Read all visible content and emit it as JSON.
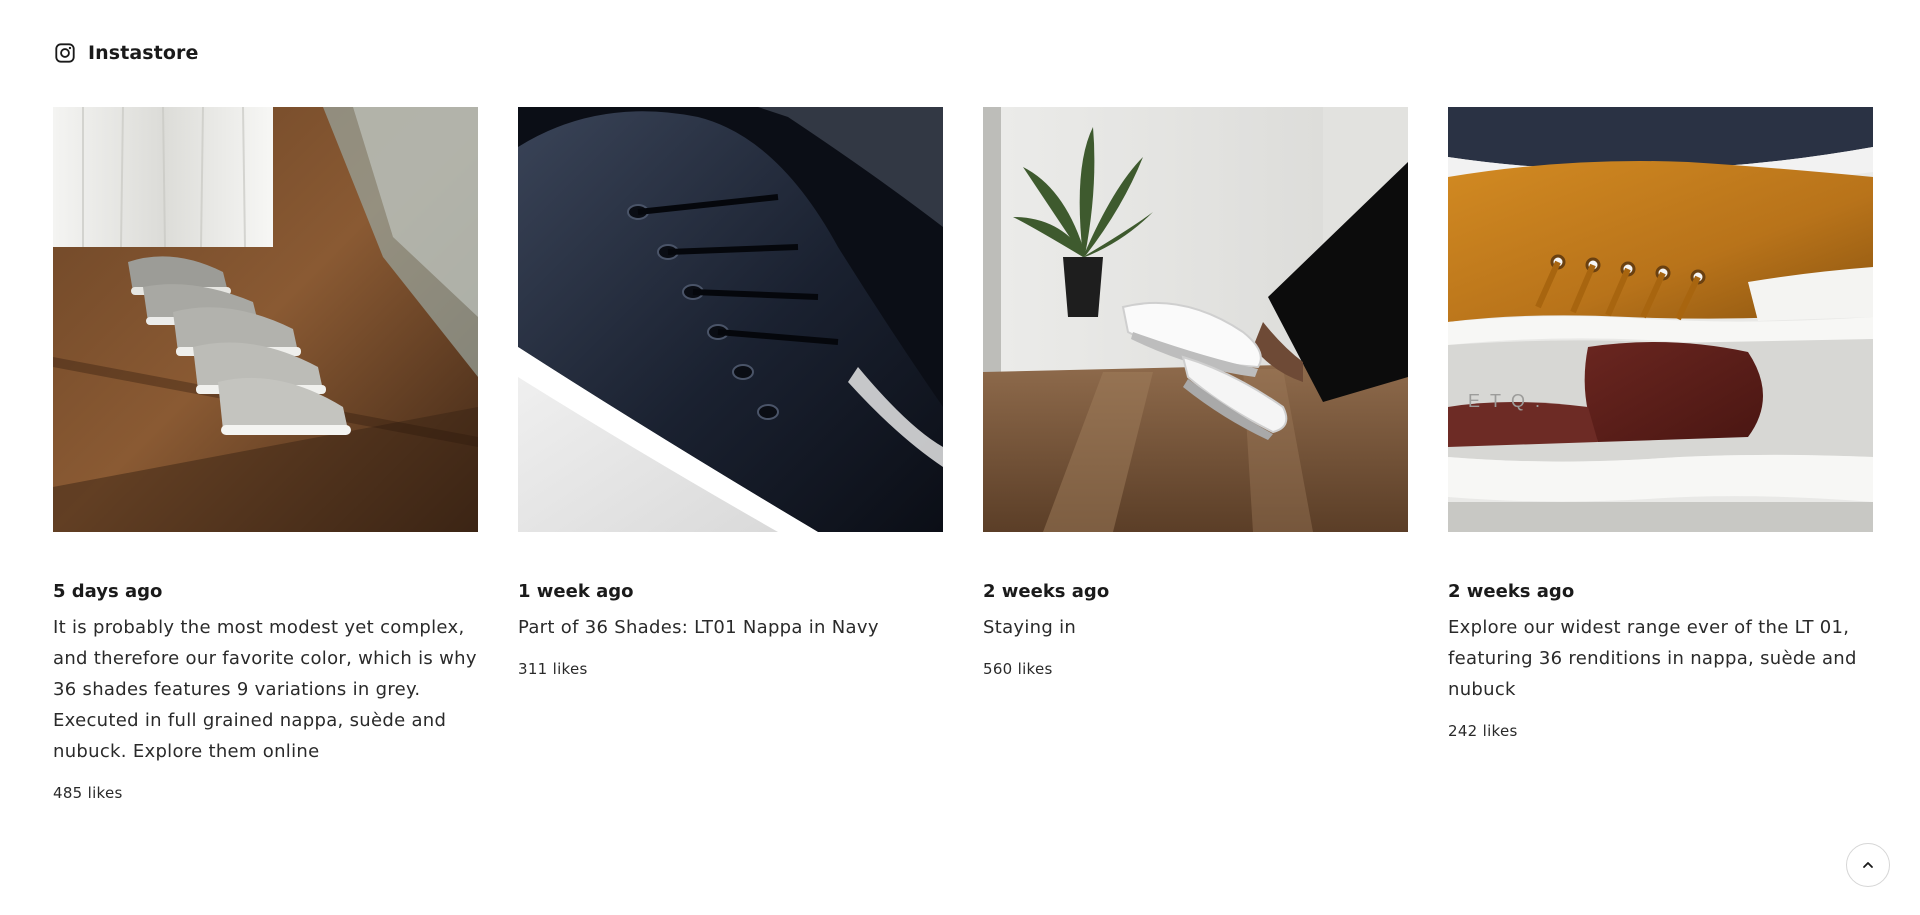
{
  "header": {
    "icon": "instagram-icon",
    "title": "Instastore"
  },
  "posts": [
    {
      "image": "grey sneakers lined up on wooden floor",
      "date": "5 days ago",
      "caption": "It is probably the most modest yet complex, and therefore our favorite color, which is why 36 shades features 9 variations in grey. Executed in full grained nappa, suède and nubuck. Explore them online",
      "likes": "485 likes"
    },
    {
      "image": "navy nappa sneaker close-up",
      "date": "1 week ago",
      "caption": "Part of 36 Shades: LT01 Nappa in Navy",
      "likes": "311 likes"
    },
    {
      "image": "white sneakers with crossed legs indoors",
      "date": "2 weeks ago",
      "caption": "Staying in",
      "likes": "560 likes"
    },
    {
      "image": "tan and burgundy suede sneakers stacked",
      "date": "2 weeks ago",
      "caption": "Explore our widest range ever of the LT 01, featuring 36 renditions in nappa, suède and nubuck",
      "likes": "242 likes"
    }
  ],
  "photo_watermark": "ETQ.",
  "scroll_top": {
    "icon": "chevron-up-icon"
  }
}
